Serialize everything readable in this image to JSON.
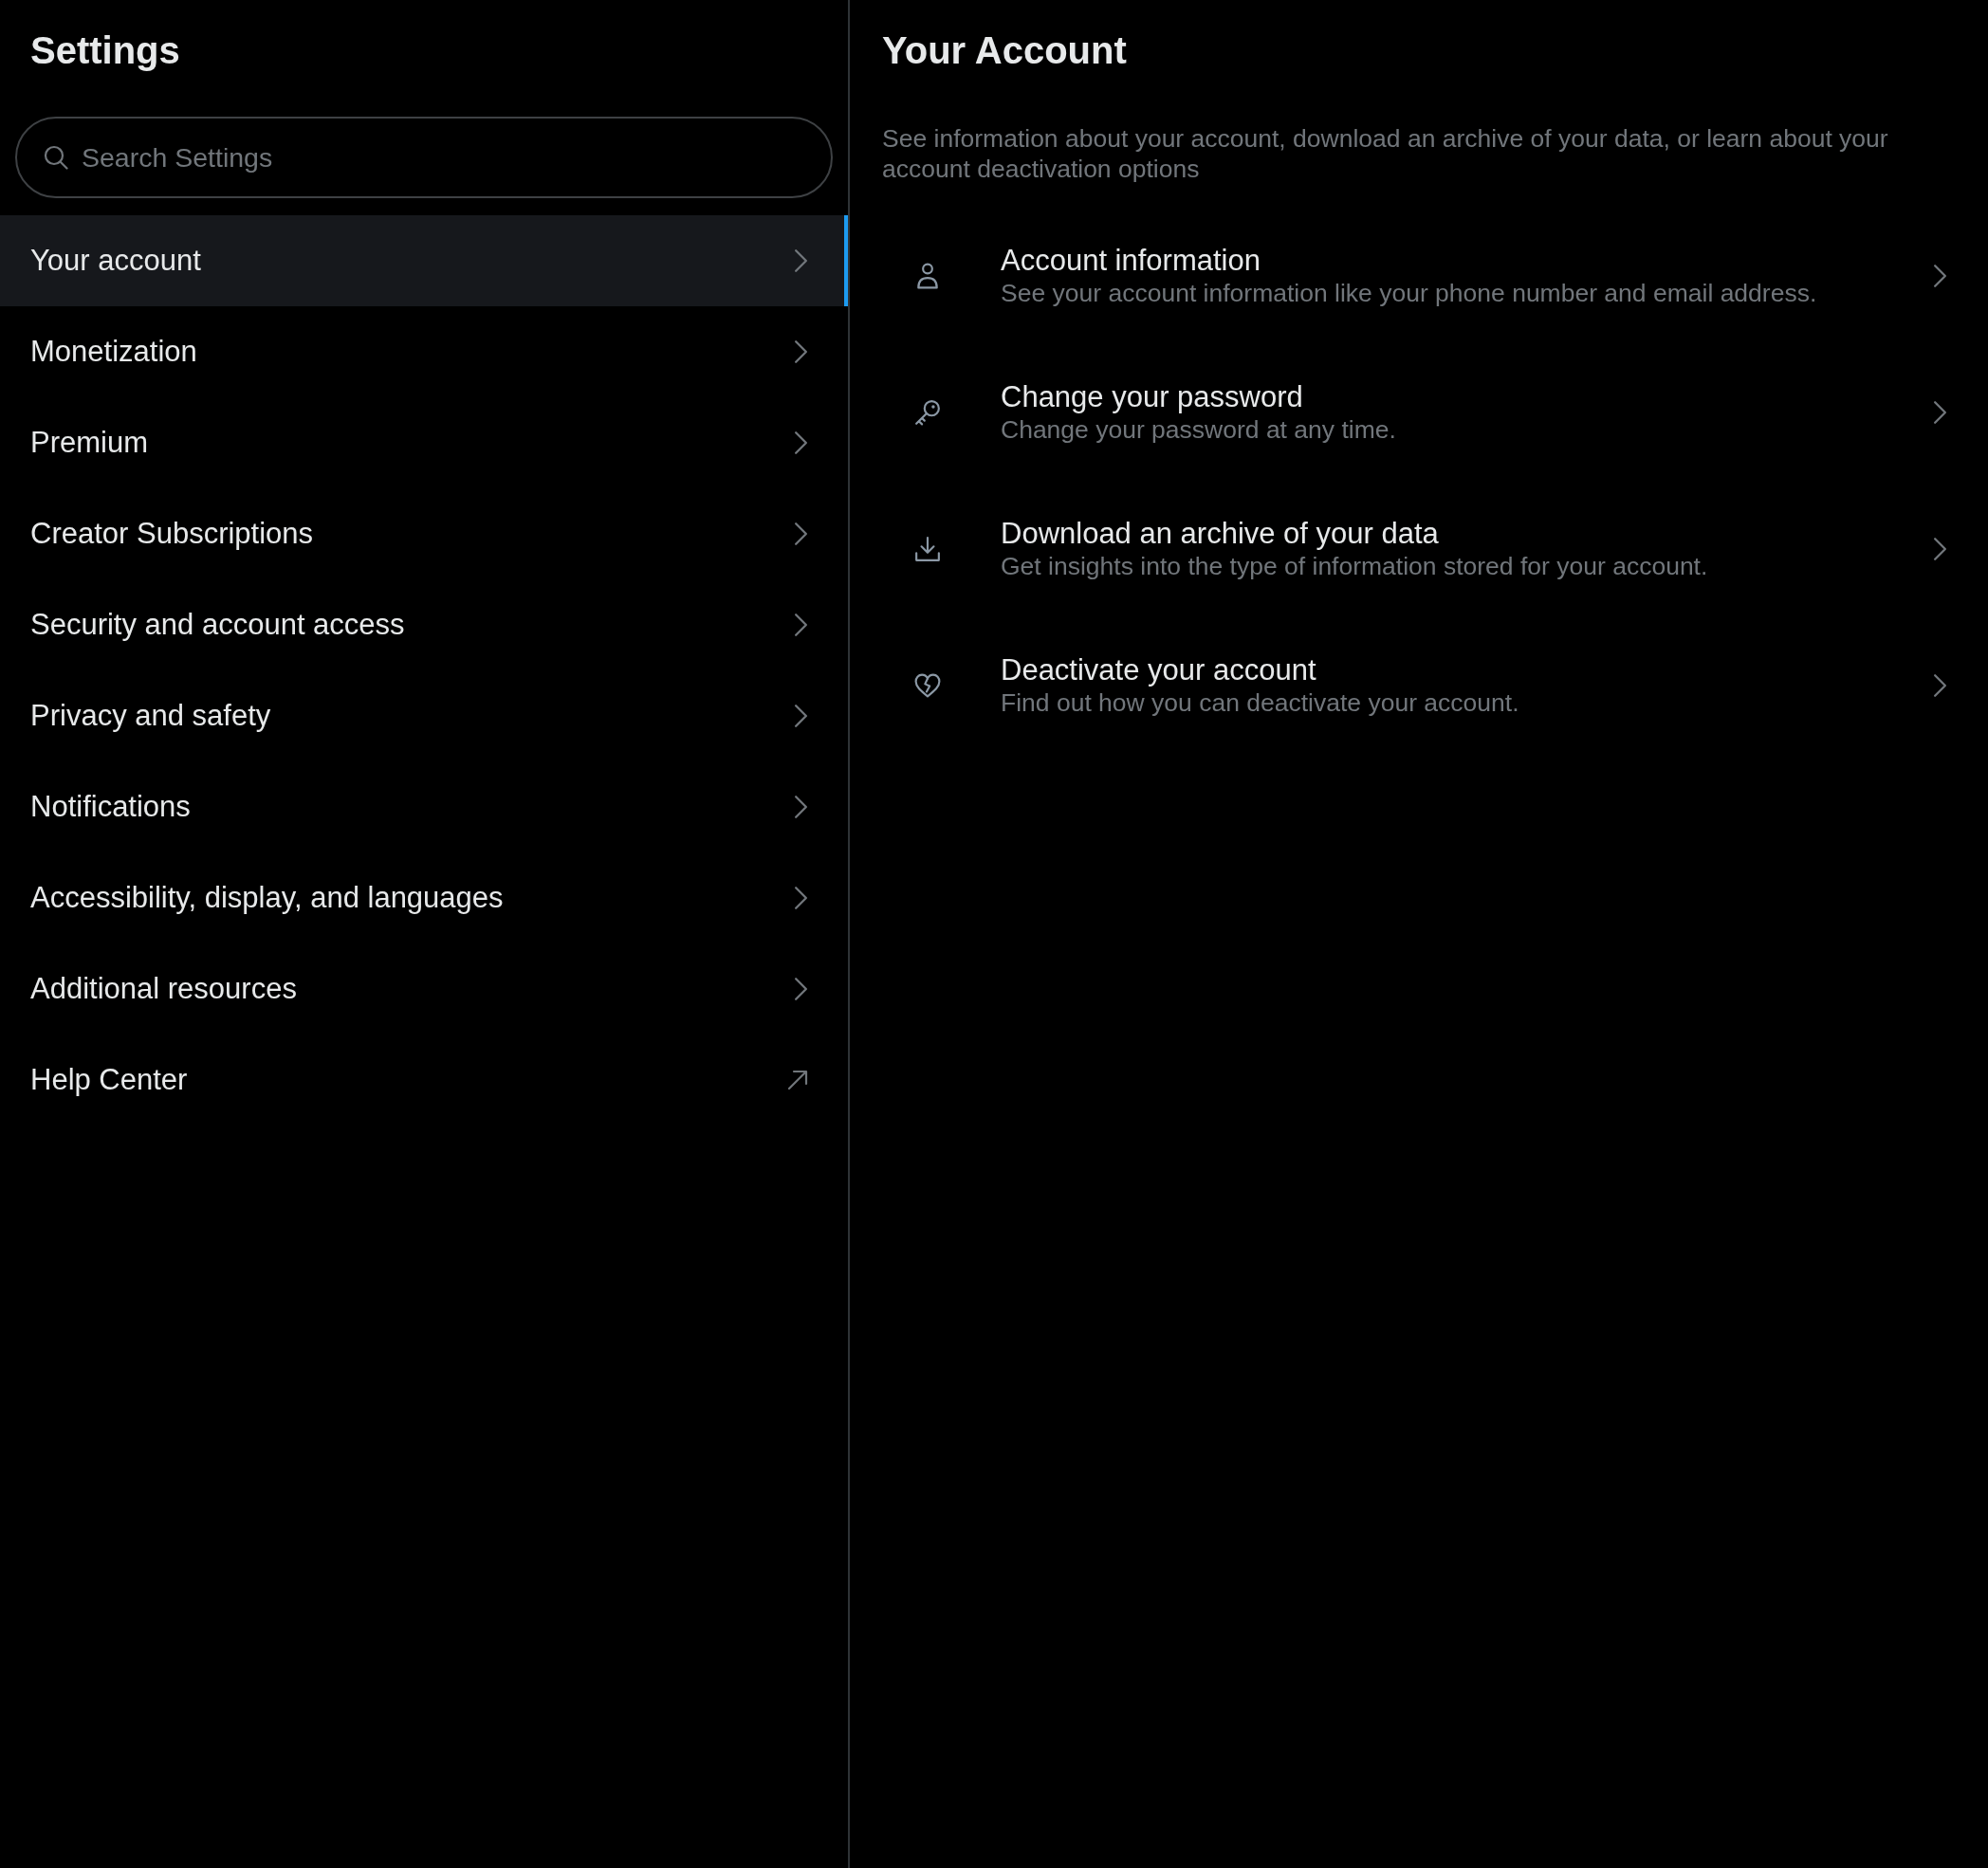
{
  "sidebar": {
    "title": "Settings",
    "search": {
      "placeholder": "Search Settings"
    },
    "items": [
      {
        "label": "Your account",
        "selected": true,
        "kind": "page"
      },
      {
        "label": "Monetization",
        "selected": false,
        "kind": "page"
      },
      {
        "label": "Premium",
        "selected": false,
        "kind": "page"
      },
      {
        "label": "Creator Subscriptions",
        "selected": false,
        "kind": "page"
      },
      {
        "label": "Security and account access",
        "selected": false,
        "kind": "page"
      },
      {
        "label": "Privacy and safety",
        "selected": false,
        "kind": "page"
      },
      {
        "label": "Notifications",
        "selected": false,
        "kind": "page"
      },
      {
        "label": "Accessibility, display, and languages",
        "selected": false,
        "kind": "page"
      },
      {
        "label": "Additional resources",
        "selected": false,
        "kind": "page"
      },
      {
        "label": "Help Center",
        "selected": false,
        "kind": "link"
      }
    ]
  },
  "main": {
    "title": "Your Account",
    "description": "See information about your account, download an archive of your data, or learn about your account deactivation options",
    "options": [
      {
        "title": "Account information",
        "description": "See your account information like your phone number and email address."
      },
      {
        "title": "Change your password",
        "description": "Change your password at any time."
      },
      {
        "title": "Download an archive of your data",
        "description": "Get insights into the type of information stored for your account."
      },
      {
        "title": "Deactivate your account",
        "description": "Find out how you can deactivate your account."
      }
    ]
  }
}
